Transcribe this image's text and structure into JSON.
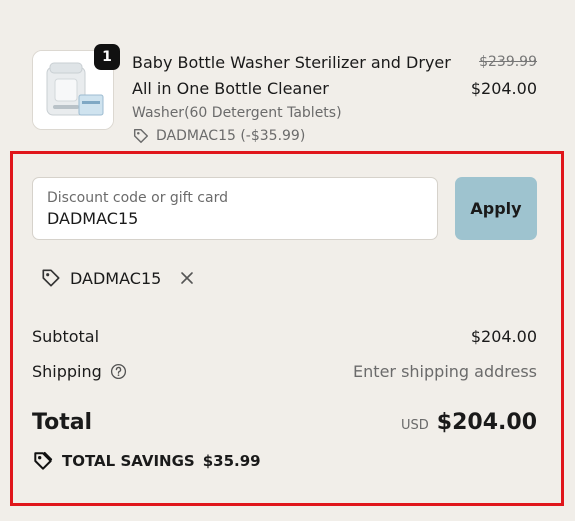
{
  "product": {
    "quantity": "1",
    "title": "Baby Bottle Washer Sterilizer and Dryer All in One Bottle Cleaner",
    "variant": "Washer(60 Detergent Tablets)",
    "discount_note": "DADMAC15 (-$35.99)",
    "original_price": "$239.99",
    "price": "$204.00",
    "image_icon": "product-image"
  },
  "discount": {
    "label": "Discount code or gift card",
    "value": "DADMAC15",
    "apply_label": "Apply",
    "applied_code": "DADMAC15"
  },
  "summary": {
    "subtotal_label": "Subtotal",
    "subtotal_value": "$204.00",
    "shipping_label": "Shipping",
    "shipping_value": "Enter shipping address",
    "total_label": "Total",
    "currency": "USD",
    "total_value": "$204.00",
    "savings_label": "TOTAL SAVINGS",
    "savings_value": "$35.99"
  },
  "colors": {
    "background": "#f1eee9",
    "apply_button": "#9ec3cf",
    "highlight_border": "#e0161b"
  }
}
